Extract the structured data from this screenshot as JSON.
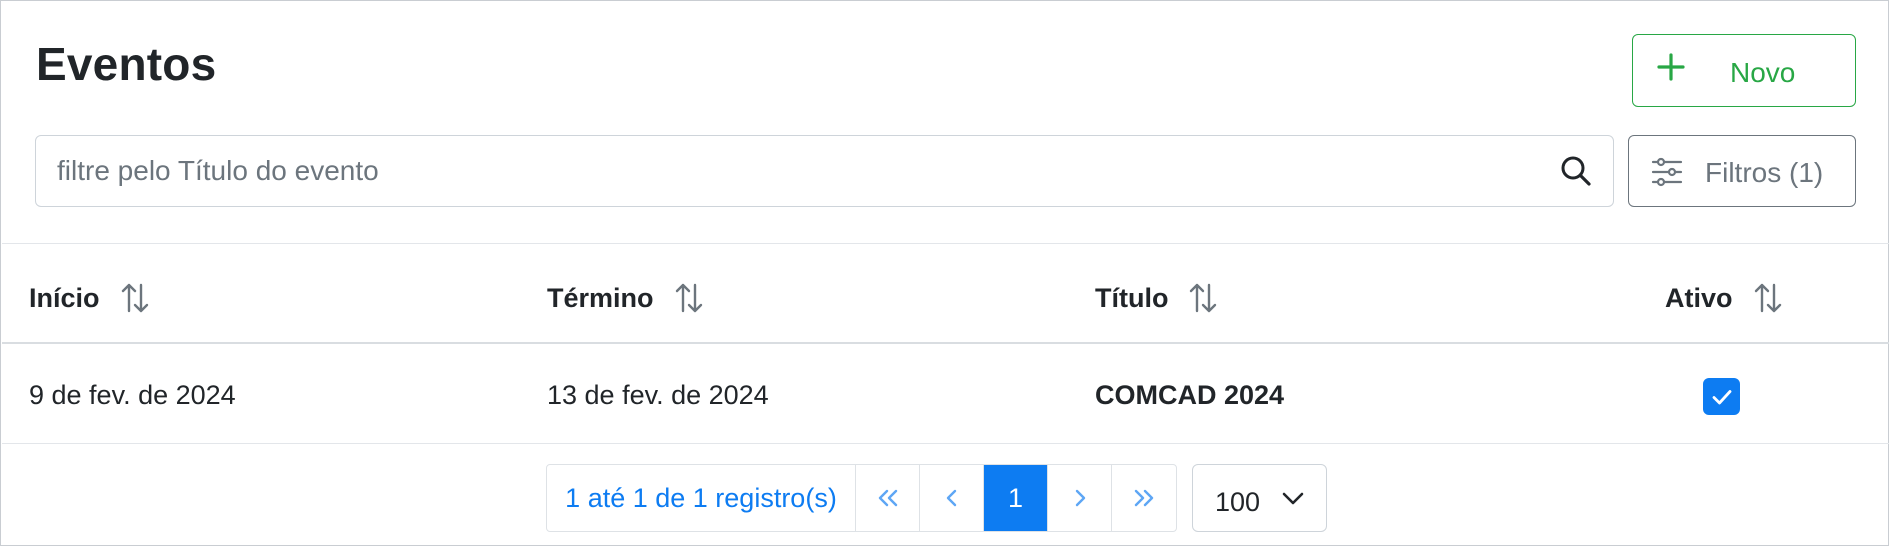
{
  "header": {
    "title": "Eventos",
    "new_button_label": "Novo"
  },
  "search": {
    "placeholder": "filtre pelo Título do evento",
    "value": ""
  },
  "filters": {
    "label": "Filtros (1)"
  },
  "table": {
    "columns": [
      "Início",
      "Término",
      "Título",
      "Ativo"
    ],
    "rows": [
      {
        "start": "9 de fev. de 2024",
        "end": "13 de fev. de 2024",
        "title": "COMCAD 2024",
        "active": true
      }
    ]
  },
  "pagination": {
    "info": "1 até 1 de 1 registro(s)",
    "current_page": "1",
    "page_size": "100"
  },
  "colors": {
    "primary": "#0d7cf2",
    "success": "#28a745",
    "muted": "#6c757d"
  },
  "icons": {
    "new": "plus-icon",
    "search": "search-icon",
    "filters": "sliders-icon",
    "sort": "sort-arrows-icon",
    "first": "double-chevron-left-icon",
    "prev": "chevron-left-icon",
    "next": "chevron-right-icon",
    "last": "double-chevron-right-icon",
    "page_size": "chevron-down-icon",
    "active": "check-icon"
  }
}
